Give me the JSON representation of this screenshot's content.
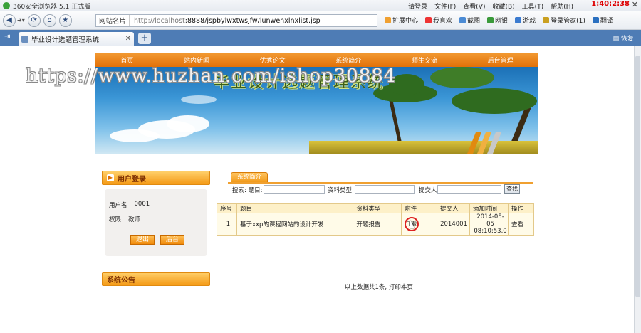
{
  "browser": {
    "title": "360安全浏览器 5.1 正式版",
    "menu": [
      "请登录",
      "文件(F)",
      "查看(V)",
      "收藏(B)",
      "工具(T)",
      "帮助(H)"
    ],
    "clock": "1:40:2:38",
    "address_site_label": "网站名片",
    "url_host": "http://localhost",
    "url_path": ":8888/jspbylwxtwsjfw/lunwenxlnxlist.jsp",
    "toolbar_items": [
      "扩展中心",
      "我喜欢",
      "截图",
      "网银",
      "游戏",
      "登录管家(1)",
      "翻译"
    ],
    "tab_label": "毕业设计选题管理系统",
    "tab_right_label": "恢复"
  },
  "site": {
    "nav": [
      "首页",
      "站内新闻",
      "优秀论文",
      "系统简介",
      "师生交流",
      "后台管理"
    ],
    "banner_title": "毕业设计选题管理系统",
    "watermark": "https://www.huzhan.com/ishop30884"
  },
  "login_panel": {
    "title": "用户登录",
    "username_label": "用户名",
    "username_value": "0001",
    "role_label": "权限",
    "role_value": "教师",
    "logout_button": "退出",
    "admin_button": "后台"
  },
  "notice_panel": {
    "title": "系统公告"
  },
  "main": {
    "section_tab": "系统简介",
    "search_title_label": "搜索: 题目:",
    "search_type_label": "资料类型",
    "search_submitter_label": "提交人",
    "search_button": "查找",
    "columns": [
      "序号",
      "题目",
      "资料类型",
      "附件",
      "提交人",
      "添加时间",
      "操作"
    ],
    "rows": [
      {
        "index": "1",
        "title": "基于xxp的课程网站的设计开发",
        "type": "开题报告",
        "attachment": "下载",
        "submitter": "2014001",
        "added_date": "2014-05-05",
        "added_time": "08:10:53.0",
        "action": "查看"
      }
    ],
    "footer": "以上数据共1条, 打印本页"
  }
}
